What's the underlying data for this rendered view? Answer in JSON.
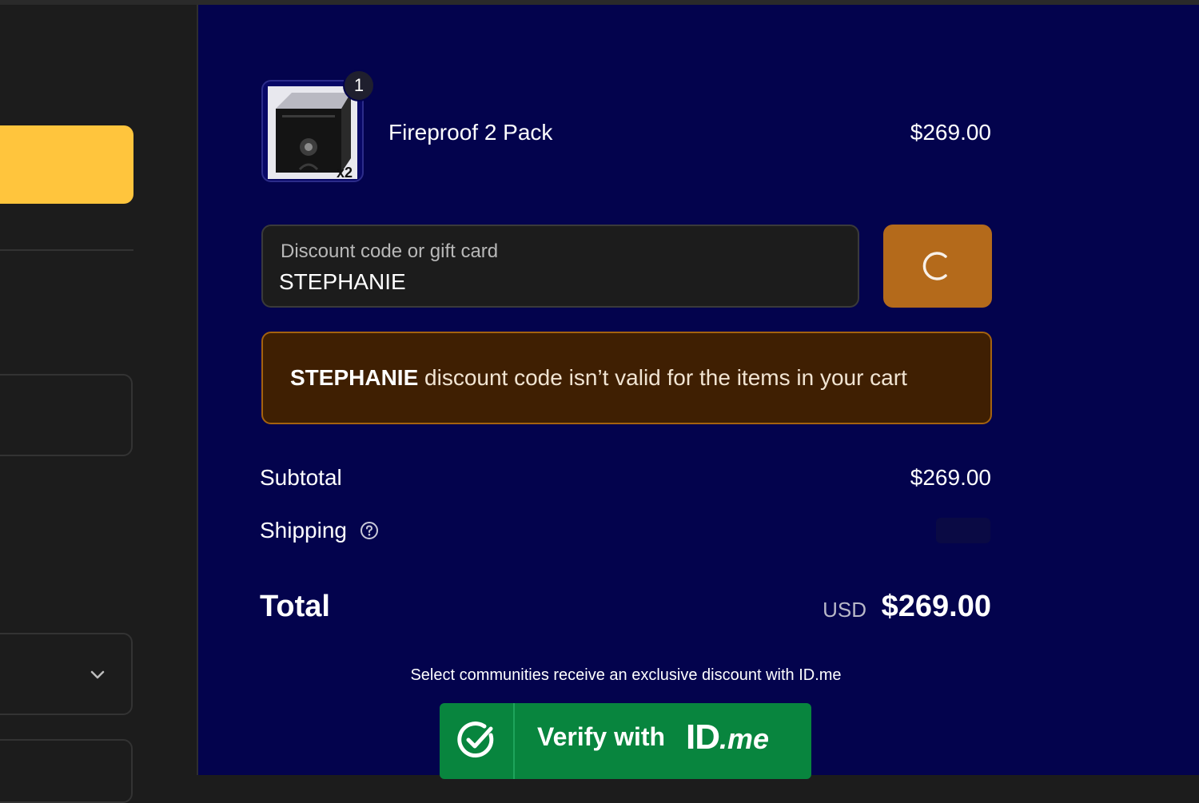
{
  "product": {
    "name": "Fireproof 2 Pack",
    "price": "$269.00",
    "quantity": "1",
    "thumb_badge": "x2"
  },
  "discount": {
    "label": "Discount code or gift card",
    "value": "STEPHANIE"
  },
  "error": {
    "code": "STEPHANIE",
    "message": " discount code isn’t valid for the items in your cart"
  },
  "summary": {
    "subtotal_label": "Subtotal",
    "subtotal_value": "$269.00",
    "shipping_label": "Shipping",
    "total_label": "Total",
    "currency": "USD",
    "total_value": "$269.00"
  },
  "idme": {
    "note": "Select communities receive an exclusive discount with ID.me",
    "verify_label": "Verify with",
    "logo_id": "ID",
    "logo_me": ".me"
  },
  "colors": {
    "right_bg": "#03034d",
    "left_bg": "#1c1c1c",
    "accent_yellow": "#ffc53d",
    "apply_button": "#b46a1b",
    "error_bg": "#3f1f02",
    "idme_green": "#08853e"
  },
  "icons": [
    "chevron-down-icon",
    "spinner-icon",
    "help-circle-icon",
    "check-circle-icon"
  ]
}
